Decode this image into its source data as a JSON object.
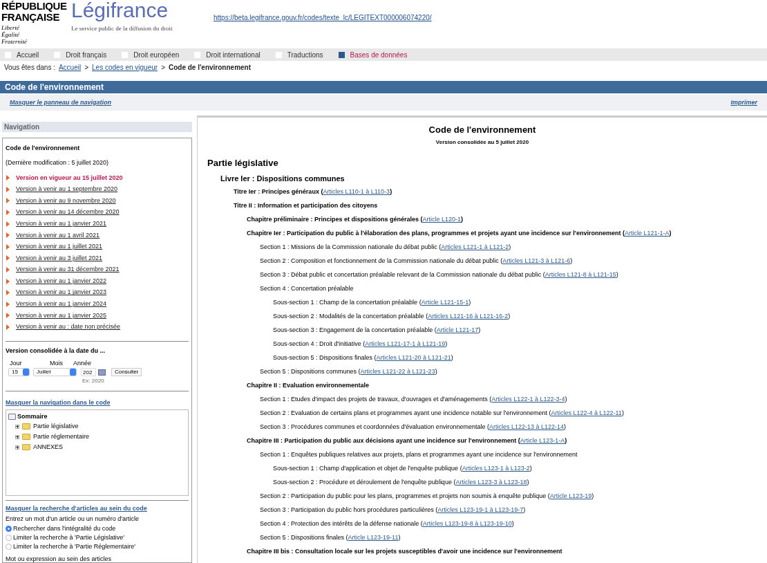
{
  "header": {
    "emblem_lines": [
      "RÉPUBLIQUE",
      "FRANÇAISE"
    ],
    "motto": [
      "Liberté",
      "Égalité",
      "Fraternité"
    ],
    "brand": "Légifrance",
    "tagline": "Le service public de la diffusion du droit",
    "url": "https://beta.legifrance.gouv.fr/codes/texte_lc/LEGITEXT000006074220/"
  },
  "nav_tabs": [
    {
      "label": "Accueil",
      "selected": false
    },
    {
      "label": "Droit français",
      "selected": false
    },
    {
      "label": "Droit européen",
      "selected": false
    },
    {
      "label": "Droit international",
      "selected": false
    },
    {
      "label": "Traductions",
      "selected": false
    },
    {
      "label": "Bases de données",
      "selected": true
    }
  ],
  "breadcrumb": {
    "prefix": "Vous êtes dans :",
    "separator": ">",
    "items": [
      {
        "label": "Accueil",
        "kind": "link"
      },
      {
        "label": "Les codes en vigueur",
        "kind": "link"
      },
      {
        "label": "Code de l'environnement",
        "kind": "current"
      }
    ]
  },
  "title_bar": "Code de l'environnement",
  "toolbar": {
    "hide_panel": "Masquer le panneau de navigation",
    "print": "Imprimer"
  },
  "sidebar": {
    "heading": "Navigation",
    "code_title": "Code de l'environnement",
    "last_modified": "(Dernière modification : 5 juillet 2020)",
    "versions": [
      {
        "label": "Version en vigueur au 15 juillet 2020",
        "selected": true
      },
      {
        "label": "Version à venir au 1 septembre 2020",
        "selected": false
      },
      {
        "label": "Version à venir au 9 novembre 2020",
        "selected": false
      },
      {
        "label": "Version à venir au 14 décembre 2020",
        "selected": false
      },
      {
        "label": "Version à venir au 1 janvier 2021",
        "selected": false
      },
      {
        "label": "Version à venir au 1 avril 2021",
        "selected": false
      },
      {
        "label": "Version à venir au 1 juillet 2021",
        "selected": false
      },
      {
        "label": "Version à venir au 3 juillet 2021",
        "selected": false
      },
      {
        "label": "Version à venir au 31 décembre 2021",
        "selected": false
      },
      {
        "label": "Version à venir au 1 janvier 2022",
        "selected": false
      },
      {
        "label": "Version à venir au 1 janvier 2023",
        "selected": false
      },
      {
        "label": "Version à venir au 1 janvier 2024",
        "selected": false
      },
      {
        "label": "Version à venir au 1 janvier 2025",
        "selected": false
      },
      {
        "label": "Version à venir au : date non précisée",
        "selected": false
      }
    ],
    "date_form": {
      "title": "Version consolidée à la date du ...",
      "day_label": "Jour",
      "month_label": "Mois",
      "year_label": "Année",
      "day": "15",
      "month": "Juillet",
      "year": "202",
      "hint": "Ex: 2020",
      "button": "Consulter"
    },
    "tree_toggle": "Masquer la navigation dans le code",
    "tree": {
      "label": "Sommaire",
      "children": [
        {
          "label": "Partie législative",
          "expanded": false
        },
        {
          "label": "Partie réglementaire",
          "expanded": false
        },
        {
          "label": "ANNEXES",
          "expanded": false
        }
      ]
    },
    "search_toggle": "Masquer la recherche d'articles au sein du code",
    "search_intro": "Entrez un mot d'un article ou un numéro d'article",
    "scopes": [
      {
        "label": "Rechercher dans l'intégralité du code",
        "selected": true
      },
      {
        "label": "Limiter la recherche à 'Partie Législative'",
        "selected": false
      },
      {
        "label": "Limiter la recherche à 'Partie Réglementaire'",
        "selected": false
      }
    ],
    "keyword_label": "Mot ou expression au sein des articles"
  },
  "content": {
    "title": "Code de l'environnement",
    "subtitle": "Version consolidée au 5 juillet 2020",
    "link_brackets": [
      "(",
      ")"
    ],
    "outline": [
      {
        "label": "Partie législative",
        "children": [
          {
            "label": "Livre Ier : Dispositions communes",
            "children": [
              {
                "label": "Titre Ier : Principes généraux",
                "link": "Articles L110-1 à L110-3"
              },
              {
                "label": "Titre II : Information et participation des citoyens",
                "children": [
                  {
                    "label": "Chapitre préliminaire : Principes et dispositions générales",
                    "link": "Article L120-1"
                  },
                  {
                    "label": "Chapitre Ier : Participation du public à l'élaboration des plans, programmes et projets ayant une incidence sur l'environnement",
                    "link": "Article L121-1-A",
                    "children": [
                      {
                        "label": "Section 1 : Missions de la Commission nationale du débat public",
                        "link": "Articles L121-1 à L121-2"
                      },
                      {
                        "label": "Section 2 : Composition et fonctionnement de la Commission nationale du débat public",
                        "link": "Articles L121-3 à L121-6"
                      },
                      {
                        "label": "Section 3 : Débat public et concertation préalable relevant de la Commission nationale du débat public",
                        "link": "Articles L121-8 à L121-15"
                      },
                      {
                        "label": "Section 4 : Concertation préalable",
                        "children": [
                          {
                            "label": "Sous-section 1 : Champ de la concertation préalable",
                            "link": "Article L121-15-1"
                          },
                          {
                            "label": "Sous-section 2 : Modalités de la concertation préalable",
                            "link": "Articles L121-16 à L121-16-2"
                          },
                          {
                            "label": "Sous-section 3 : Engagement de la concertation préalable",
                            "link": "Article L121-17"
                          },
                          {
                            "label": "Sous-section 4 : Droit d'initiative",
                            "link": "Articles L121-17-1 à L121-19"
                          },
                          {
                            "label": "Sous-section 5 : Dispositions finales",
                            "link": "Articles L121-20 à L121-21"
                          }
                        ]
                      },
                      {
                        "label": "Section 5 : Dispositions communes",
                        "link": "Articles L121-22 à L121-23"
                      }
                    ]
                  },
                  {
                    "label": "Chapitre II : Evaluation environnementale",
                    "children": [
                      {
                        "label": "Section 1 : Etudes d'impact des projets de travaux, d'ouvrages et d'aménagements",
                        "link": "Articles L122-1 à L122-3-4"
                      },
                      {
                        "label": "Section 2 : Evaluation de certains plans et programmes ayant une incidence notable sur l'environnement",
                        "link": "Articles L122-4 à L122-11"
                      },
                      {
                        "label": "Section 3 : Procédures communes et coordonnées d'évaluation environnementale",
                        "link": "Articles L122-13 à L122-14"
                      }
                    ]
                  },
                  {
                    "label": "Chapitre III : Participation du public aux décisions ayant une incidence sur l'environnement",
                    "link": "Article L123-1-A",
                    "children": [
                      {
                        "label": "Section 1 : Enquêtes publiques relatives aux projets, plans et programmes ayant une incidence sur l'environnement",
                        "children": [
                          {
                            "label": "Sous-section 1 : Champ d'application et objet de l'enquête publique",
                            "link": "Articles L123-1 à L123-2"
                          },
                          {
                            "label": "Sous-section 2 : Procédure et déroulement de l'enquête publique",
                            "link": "Articles L123-3 à L123-18"
                          }
                        ]
                      },
                      {
                        "label": "Section 2 : Participation du public pour les plans, programmes et projets non soumis à enquête publique",
                        "link": "Article L123-19"
                      },
                      {
                        "label": "Section 3 : Participation du public hors procédures particulières",
                        "link": "Articles L123-19-1 à L123-19-7"
                      },
                      {
                        "label": "Section 4 : Protection des intérêts de la défense nationale",
                        "link": "Articles L123-19-8 à L123-19-10"
                      },
                      {
                        "label": "Section 5 : Dispositions finales",
                        "link": "Article L123-19-11"
                      }
                    ]
                  },
                  {
                    "label": "Chapitre III bis : Consultation locale sur les projets susceptibles d'avoir une incidence sur l'environnement"
                  }
                ]
              }
            ]
          }
        ]
      }
    ]
  }
}
